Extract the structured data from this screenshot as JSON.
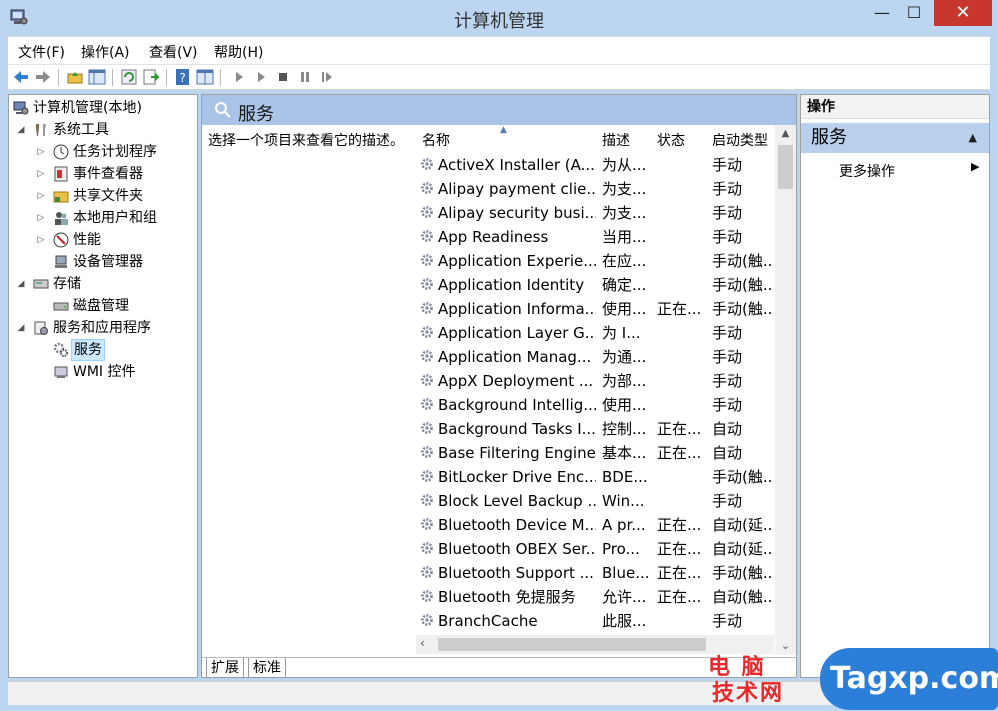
{
  "window": {
    "title": "计算机管理",
    "minimize": "—",
    "maximize": "☐",
    "close": "✕"
  },
  "menu": [
    "文件(F)",
    "操作(A)",
    "查看(V)",
    "帮助(H)"
  ],
  "tree": [
    {
      "label": "计算机管理(本地)",
      "icon": "computer-management-icon",
      "level": 0,
      "arrow": ""
    },
    {
      "label": "系统工具",
      "icon": "tools-icon",
      "level": 1,
      "arrow": "◢"
    },
    {
      "label": "任务计划程序",
      "icon": "clock-icon",
      "level": 2,
      "arrow": "▷"
    },
    {
      "label": "事件查看器",
      "icon": "event-viewer-icon",
      "level": 2,
      "arrow": "▷"
    },
    {
      "label": "共享文件夹",
      "icon": "shared-folder-icon",
      "level": 2,
      "arrow": "▷"
    },
    {
      "label": "本地用户和组",
      "icon": "users-icon",
      "level": 2,
      "arrow": "▷"
    },
    {
      "label": "性能",
      "icon": "performance-icon",
      "level": 2,
      "arrow": "▷"
    },
    {
      "label": "设备管理器",
      "icon": "device-manager-icon",
      "level": 2,
      "arrow": ""
    },
    {
      "label": "存储",
      "icon": "storage-icon",
      "level": 1,
      "arrow": "◢"
    },
    {
      "label": "磁盘管理",
      "icon": "disk-icon",
      "level": 2,
      "arrow": ""
    },
    {
      "label": "服务和应用程序",
      "icon": "services-apps-icon",
      "level": 1,
      "arrow": "◢"
    },
    {
      "label": "服务",
      "icon": "services-icon",
      "level": 2,
      "arrow": "",
      "selected": true
    },
    {
      "label": "WMI 控件",
      "icon": "wmi-icon",
      "level": 2,
      "arrow": ""
    }
  ],
  "center": {
    "title": "服务",
    "description": "选择一个项目来查看它的描述。",
    "columns": {
      "name": "名称",
      "desc": "描述",
      "status": "状态",
      "startup": "启动类型"
    },
    "rows": [
      {
        "name": "ActiveX Installer (A...",
        "desc": "为从...",
        "status": "",
        "type": "手动"
      },
      {
        "name": "Alipay payment clie...",
        "desc": "为支...",
        "status": "",
        "type": "手动"
      },
      {
        "name": "Alipay security busi...",
        "desc": "为支...",
        "status": "",
        "type": "手动"
      },
      {
        "name": "App Readiness",
        "desc": "当用...",
        "status": "",
        "type": "手动"
      },
      {
        "name": "Application Experie...",
        "desc": "在应...",
        "status": "",
        "type": "手动(触..."
      },
      {
        "name": "Application Identity",
        "desc": "确定...",
        "status": "",
        "type": "手动(触..."
      },
      {
        "name": "Application Informa...",
        "desc": "使用...",
        "status": "正在...",
        "type": "手动(触..."
      },
      {
        "name": "Application Layer G...",
        "desc": "为 I...",
        "status": "",
        "type": "手动"
      },
      {
        "name": "Application Manag...",
        "desc": "为通...",
        "status": "",
        "type": "手动"
      },
      {
        "name": "AppX Deployment ...",
        "desc": "为部...",
        "status": "",
        "type": "手动"
      },
      {
        "name": "Background Intellig...",
        "desc": "使用...",
        "status": "",
        "type": "手动"
      },
      {
        "name": "Background Tasks I...",
        "desc": "控制...",
        "status": "正在...",
        "type": "自动"
      },
      {
        "name": "Base Filtering Engine",
        "desc": "基本...",
        "status": "正在...",
        "type": "自动"
      },
      {
        "name": "BitLocker Drive Enc...",
        "desc": "BDE...",
        "status": "",
        "type": "手动(触..."
      },
      {
        "name": "Block Level Backup ...",
        "desc": "Win...",
        "status": "",
        "type": "手动"
      },
      {
        "name": "Bluetooth Device M...",
        "desc": "A pr...",
        "status": "正在...",
        "type": "自动(延..."
      },
      {
        "name": "Bluetooth OBEX Ser...",
        "desc": "Pro...",
        "status": "正在...",
        "type": "自动(延..."
      },
      {
        "name": "Bluetooth Support ...",
        "desc": "Blue...",
        "status": "正在...",
        "type": "手动(触..."
      },
      {
        "name": "Bluetooth 免提服务",
        "desc": "允许...",
        "status": "正在...",
        "type": "自动(触..."
      },
      {
        "name": "BranchCache",
        "desc": "此服...",
        "status": "",
        "type": "手动"
      }
    ],
    "tabs": [
      "扩展",
      "标准"
    ]
  },
  "actions": {
    "header": "操作",
    "section": "服务",
    "more": "更多操作"
  },
  "watermark": {
    "line1": "电 脑",
    "line2": "技术网",
    "logo": "Tagxp.com"
  }
}
